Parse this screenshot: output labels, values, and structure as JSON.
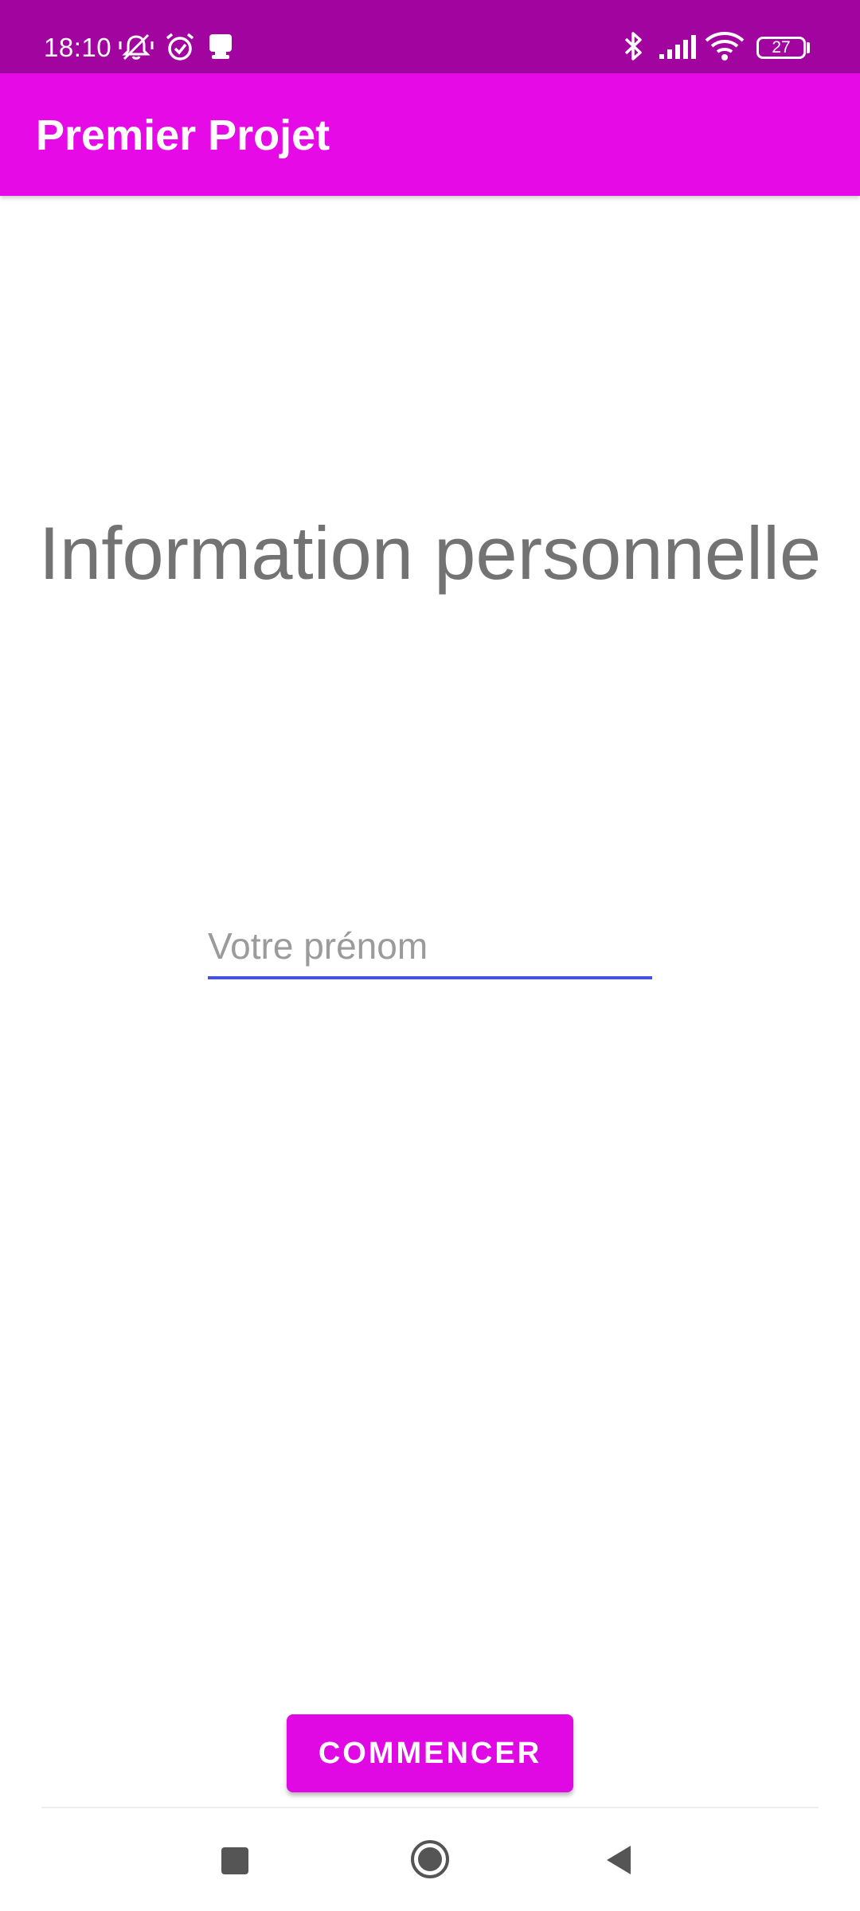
{
  "status_bar": {
    "time": "18:10",
    "battery_level": "27",
    "background": "#a1049f",
    "icons": [
      "mute-icon",
      "alarm-icon",
      "notification-icon",
      "bluetooth-icon",
      "signal-icon",
      "wifi-icon",
      "battery-icon"
    ]
  },
  "app_bar": {
    "title": "Premier Projet",
    "background": "#e50ae6"
  },
  "main": {
    "heading": "Information personnelle",
    "first_name_field": {
      "placeholder": "Votre prénom",
      "value": "",
      "underline_color": "#4353e0"
    },
    "start_button": {
      "label": "COMMENCER",
      "background": "#e009e4"
    }
  },
  "nav_bar": {
    "buttons": [
      "recents-button",
      "home-button",
      "back-button"
    ]
  }
}
